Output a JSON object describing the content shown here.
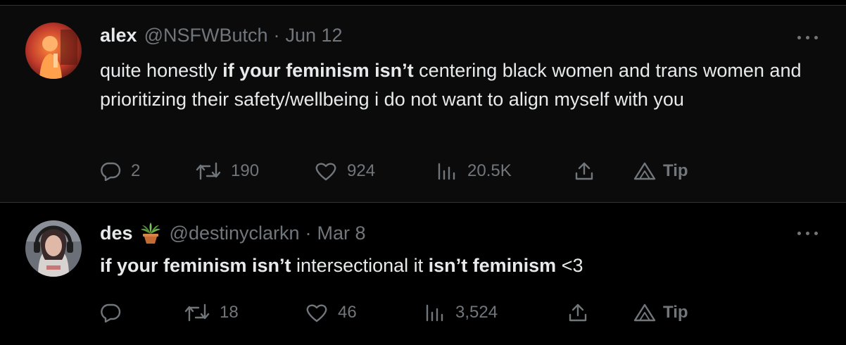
{
  "tweets": [
    {
      "name": "alex",
      "handle": "@NSFWButch",
      "separator": "·",
      "date": "Jun 12",
      "text_parts": [
        "quite honestly ",
        "if your feminism isn’t",
        " centering black women and trans women and prioritizing their safety/wellbeing i do not want to align myself with you"
      ],
      "replies": "2",
      "retweets": "190",
      "likes": "924",
      "views": "20.5K",
      "tip_label": "Tip",
      "avatar": {
        "kind": "photo",
        "description": "orange-toned photo"
      }
    },
    {
      "name": "des",
      "name_emoji": "potted-plant",
      "handle": "@destinyclarkn",
      "separator": "·",
      "date": "Mar 8",
      "text_parts": [
        "if your feminism isn’t",
        " intersectional it ",
        "isn’t feminism",
        " <3"
      ],
      "replies": "",
      "retweets": "18",
      "likes": "46",
      "views": "3,524",
      "tip_label": "Tip",
      "avatar": {
        "kind": "photo",
        "description": "person with headphones"
      }
    }
  ],
  "colors": {
    "background": "#000000",
    "text": "#e7e9ea",
    "muted": "#71767b",
    "divider": "#2f3336"
  }
}
